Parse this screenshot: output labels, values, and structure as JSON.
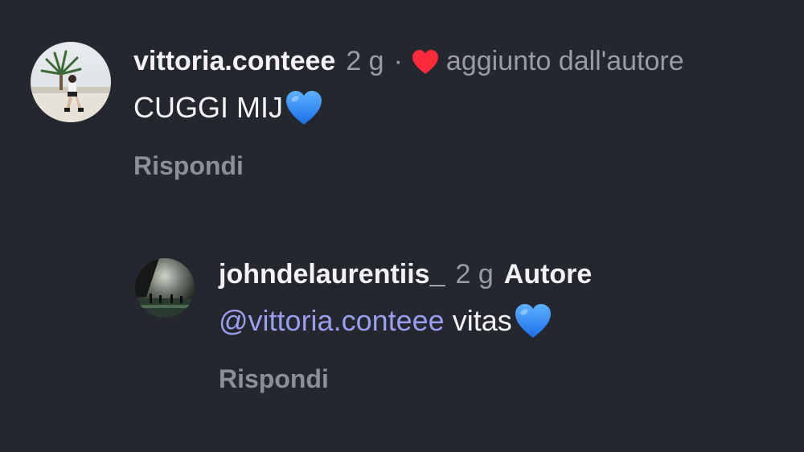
{
  "comment": {
    "username": "vittoria.conteee",
    "time": "2 g",
    "separator": "·",
    "liked_by_author_text": "aggiunto dall'autore",
    "text": "CUGGI MIJ",
    "emoji": "blue-heart-icon",
    "reply_label": "Rispondi"
  },
  "reply": {
    "username": "johndelaurentiis_",
    "time": "2 g",
    "author_badge": "Autore",
    "mention": "@vittoria.conteee",
    "text": " vitas",
    "emoji": "blue-heart-icon",
    "reply_label": "Rispondi"
  },
  "colors": {
    "background": "#25272e",
    "heart_red": "#ff2a3b",
    "mention_blue": "#9b9df0",
    "blue_heart": "#2f8cf5"
  }
}
